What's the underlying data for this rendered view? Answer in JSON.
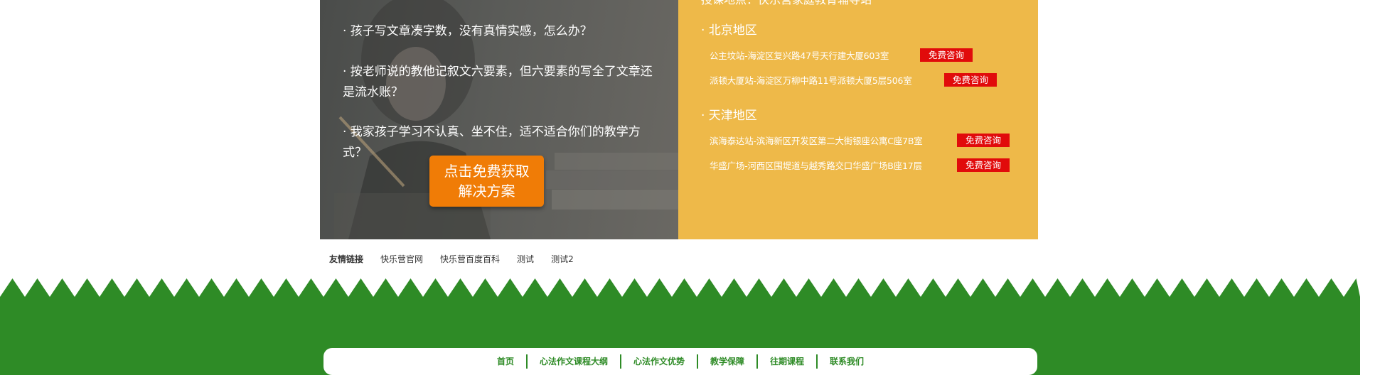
{
  "left_panel": {
    "questions": [
      "· 孩子写文章凑字数，没有真情实感，怎么办？",
      "· 按老师说的教他记叙文六要素，但六要素的写全了文章还是流水账？",
      "· 我家孩子学习不认真、坐不住，适不适合你们的教学方式？"
    ],
    "cta": {
      "line1": "点击免费获取",
      "line2": "解决方案"
    }
  },
  "right_panel": {
    "heading": "授课地点：快乐营家庭教育辅导站",
    "regions": [
      {
        "title": "· 北京地区",
        "branches": [
          {
            "text": "公主坟站-海淀区复兴路47号天行建大厦603室",
            "button": "免费咨询"
          },
          {
            "text": "派顿大厦站-海淀区万柳中路11号派顿大厦5层506室",
            "button": "免费咨询"
          }
        ]
      },
      {
        "title": "· 天津地区",
        "branches": [
          {
            "text": "滨海泰达站-滨海新区开发区第二大街银座公寓C座7B室",
            "button": "免费咨询"
          },
          {
            "text": "华盛广场-河西区围堤道与越秀路交口华盛广场B座17层",
            "button": "免费咨询"
          }
        ]
      }
    ]
  },
  "friend_links": {
    "title": "友情链接",
    "links": [
      "快乐营官网",
      "快乐营百度百科",
      "测试",
      "测试2"
    ]
  },
  "footer_nav": {
    "items": [
      "首页",
      "心法作文课程大纲",
      "心法作文优势",
      "教学保障",
      "往期课程",
      "联系我们"
    ]
  },
  "colors": {
    "yellow_panel": "#eeb949",
    "cta_orange": "#f07c06",
    "consult_red": "#e10b0b",
    "footer_green": "#2e8b26"
  }
}
